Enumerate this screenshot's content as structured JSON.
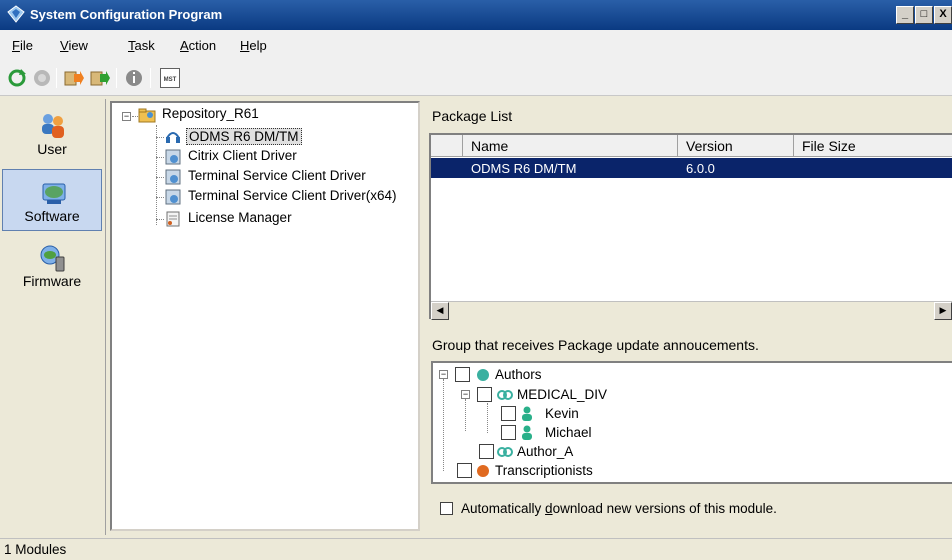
{
  "window": {
    "title": "System Configuration Program",
    "controls": [
      "_",
      "□",
      "X"
    ]
  },
  "menu": [
    {
      "label": "File",
      "mnemonic": "F"
    },
    {
      "label": "View",
      "mnemonic": "V"
    },
    {
      "label": "Task",
      "mnemonic": "T"
    },
    {
      "label": "Action",
      "mnemonic": "A"
    },
    {
      "label": "Help",
      "mnemonic": "H"
    }
  ],
  "toolbar": {
    "icons": [
      "refresh-icon",
      "disabled-icon",
      "import-icon",
      "export-icon",
      "info-icon",
      "mst-icon"
    ],
    "mst_label": "MST"
  },
  "nav": [
    {
      "label": "User",
      "icon": "users-icon",
      "selected": false
    },
    {
      "label": "Software",
      "icon": "software-icon",
      "selected": true
    },
    {
      "label": "Firmware",
      "icon": "firmware-icon",
      "selected": false
    }
  ],
  "tree": {
    "root": "Repository_R61",
    "items": [
      {
        "label": "ODMS R6 DM/TM",
        "selected": true
      },
      {
        "label": "Citrix Client Driver",
        "selected": false
      },
      {
        "label": "Terminal Service Client Driver",
        "selected": false
      },
      {
        "label": "Terminal Service Client Driver(x64)",
        "selected": false
      },
      {
        "label": "License Manager",
        "selected": false
      }
    ]
  },
  "package_list": {
    "title": "Package List",
    "columns": [
      "Name",
      "Version",
      "File Size"
    ],
    "rows": [
      {
        "name": "ODMS R6 DM/TM",
        "version": "6.0.0",
        "size": ""
      }
    ]
  },
  "group": {
    "title": "Group that receives Package update annoucements.",
    "nodes": {
      "authors": "Authors",
      "medical_div": "MEDICAL_DIV",
      "kevin": "Kevin",
      "michael": "Michael",
      "author_a": "Author_A",
      "transcriptionists": "Transcriptionists"
    }
  },
  "auto_download": {
    "pre": "Automatically ",
    "mnemonic": "d",
    "post": "ownload new versions of this module.",
    "checked": false
  },
  "status": {
    "text": "1 Modules"
  },
  "colors": {
    "title_bar": "#0a3a82",
    "selection": "#0a246a",
    "window_bg": "#ece9d8"
  }
}
